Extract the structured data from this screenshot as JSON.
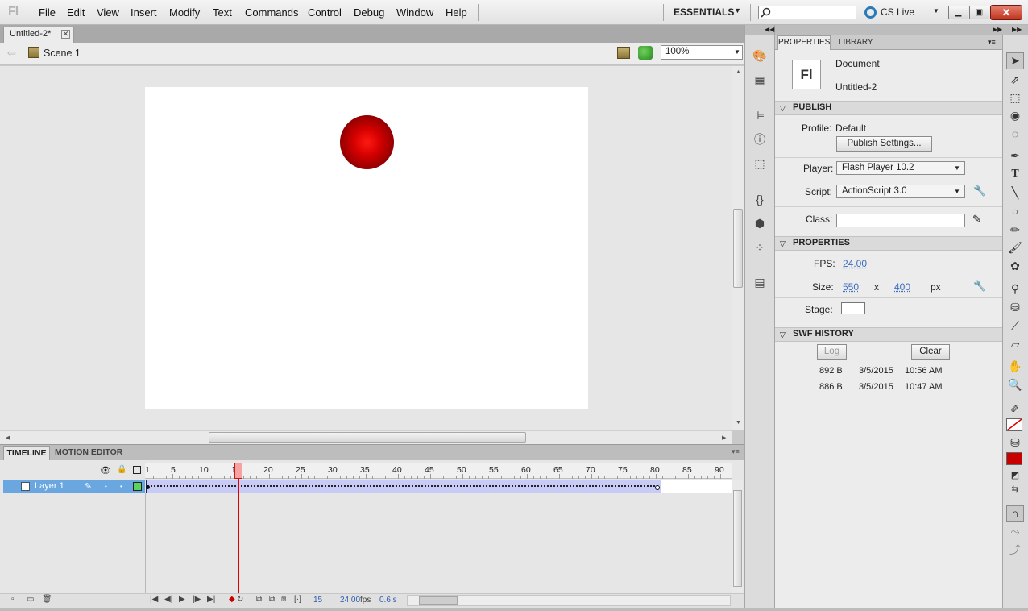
{
  "app": {
    "logo_text": "Fl"
  },
  "menubar": {
    "items": [
      "File",
      "Edit",
      "View",
      "Insert",
      "Modify",
      "Text",
      "Commands",
      "Control",
      "Debug",
      "Window",
      "Help"
    ],
    "workspace": "ESSENTIALS",
    "cslive": "CS Live",
    "search_placeholder": ""
  },
  "document_tab": {
    "title": "Untitled-2*"
  },
  "edit_bar": {
    "scene": "Scene 1",
    "zoom": "100%"
  },
  "stage": {
    "width": 550,
    "height": 400,
    "background": "#ffffff",
    "ball_color": "#d40000"
  },
  "timeline": {
    "tabs": [
      "TIMELINE",
      "MOTION EDITOR"
    ],
    "ruler_ticks": [
      "1",
      "5",
      "10",
      "15",
      "20",
      "25",
      "30",
      "35",
      "40",
      "45",
      "50",
      "55",
      "60",
      "65",
      "70",
      "75",
      "80",
      "85",
      "90"
    ],
    "layer_name": "Layer 1",
    "current_frame": "15",
    "fps": "24.00",
    "fps_unit": "fps",
    "elapsed": "0.6 s",
    "tween_end_frame": 80
  },
  "properties": {
    "tabs": [
      "PROPERTIES",
      "LIBRARY"
    ],
    "doc_type": "Document",
    "doc_name": "Untitled-2",
    "publish": {
      "header": "PUBLISH",
      "profile_label": "Profile:",
      "profile_value": "Default",
      "publish_settings_btn": "Publish Settings...",
      "player_label": "Player:",
      "player_value": "Flash Player 10.2",
      "script_label": "Script:",
      "script_value": "ActionScript 3.0",
      "class_label": "Class:"
    },
    "props": {
      "header": "PROPERTIES",
      "fps_label": "FPS:",
      "fps_value": "24.00",
      "size_label": "Size:",
      "width": "550",
      "x": "x",
      "height": "400",
      "unit": "px",
      "stage_label": "Stage:"
    },
    "swf_history": {
      "header": "SWF HISTORY",
      "log_btn": "Log",
      "clear_btn": "Clear",
      "entries": [
        {
          "size": "892 B",
          "date": "3/5/2015",
          "time": "10:56 AM"
        },
        {
          "size": "886 B",
          "date": "3/5/2015",
          "time": "10:47 AM"
        }
      ]
    }
  },
  "tools": {
    "fill_color": "#c80000",
    "stroke_color": "#ffffff"
  }
}
